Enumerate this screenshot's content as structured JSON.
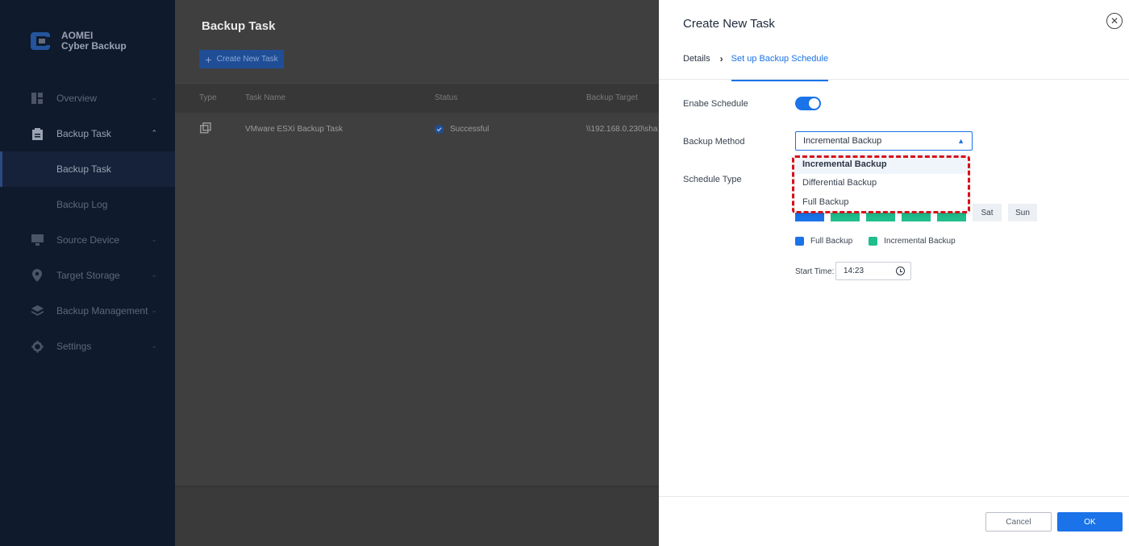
{
  "app": {
    "logo_line1": "AOMEI",
    "logo_line2": "Cyber Backup"
  },
  "sidebar": {
    "items": [
      {
        "label": "Overview",
        "icon": "dashboard-icon"
      },
      {
        "label": "Backup Task",
        "icon": "clipboard-icon"
      },
      {
        "label": "Source Device",
        "icon": "monitor-icon"
      },
      {
        "label": "Target Storage",
        "icon": "location-pin-icon"
      },
      {
        "label": "Backup Management",
        "icon": "layers-icon"
      },
      {
        "label": "Settings",
        "icon": "gear-icon"
      }
    ],
    "sub_items": [
      {
        "label": "Backup Task"
      },
      {
        "label": "Backup Log"
      }
    ]
  },
  "main": {
    "title": "Backup Task",
    "create_button": "Create New Task",
    "columns": [
      "Type",
      "Task Name",
      "Status",
      "Backup Target"
    ],
    "rows": [
      {
        "task_name": "VMware ESXi Backup Task",
        "status": "Successful",
        "target": "\\\\192.168.0.230\\sha"
      }
    ]
  },
  "drawer": {
    "title": "Create New Task",
    "steps": [
      "Details",
      "Set up Backup Schedule"
    ],
    "enable_schedule_label": "Enabe Schedule",
    "enable_schedule_on": true,
    "backup_method_label": "Backup Method",
    "backup_method_value": "Incremental Backup",
    "backup_method_options": [
      "Incremental Backup",
      "Differential Backup",
      "Full Backup"
    ],
    "schedule_type_label": "Schedule Type",
    "days_visible": [
      "Sat",
      "Sun"
    ],
    "legend": [
      "Full Backup",
      "Incremental Backup"
    ],
    "start_time_label": "Start Time:",
    "start_time_value": "14:23",
    "cancel_label": "Cancel",
    "ok_label": "OK"
  },
  "colors": {
    "accent": "#1a73e8",
    "full_backup": "#1a73e8",
    "incremental_backup": "#20be8c",
    "highlight_box": "#d6101b",
    "success": "#1a73e8"
  }
}
